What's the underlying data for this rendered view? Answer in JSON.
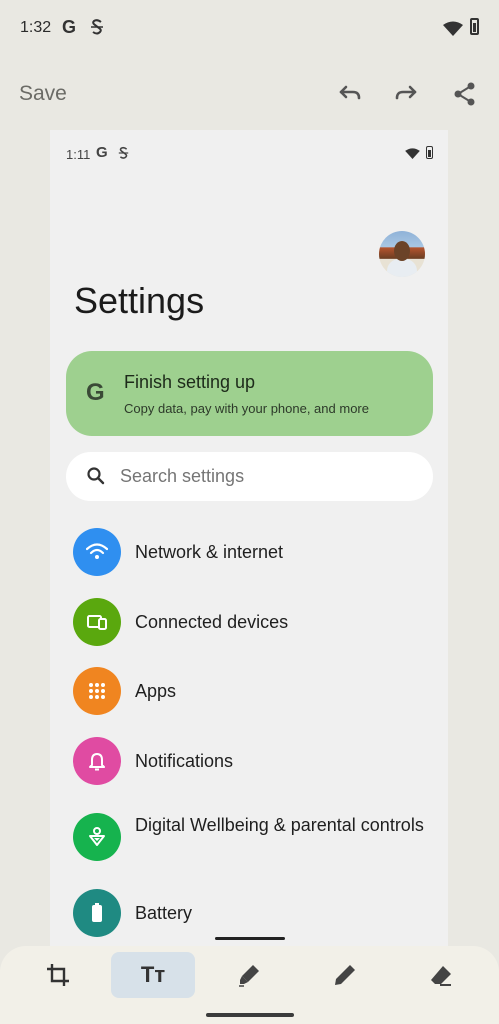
{
  "outer_status": {
    "time": "1:32",
    "g": "G"
  },
  "toolbar": {
    "save_label": "Save"
  },
  "inner_status": {
    "time": "1:11",
    "g": "G"
  },
  "settings": {
    "title": "Settings",
    "setup_card": {
      "g": "G",
      "title": "Finish setting up",
      "subtitle": "Copy data, pay with your phone, and more"
    },
    "search": {
      "placeholder": "Search settings"
    },
    "items": [
      {
        "label": "Network & internet",
        "icon": "wifi-icon",
        "color": "#2f8ff0"
      },
      {
        "label": "Connected devices",
        "icon": "devices-icon",
        "color": "#5aa80e"
      },
      {
        "label": "Apps",
        "icon": "apps-grid-icon",
        "color": "#f08520"
      },
      {
        "label": "Notifications",
        "icon": "bell-icon",
        "color": "#e04ba2"
      },
      {
        "label": "Digital Wellbeing & parental controls",
        "icon": "wellbeing-icon",
        "color": "#16b34e"
      },
      {
        "label": "Battery",
        "icon": "battery-icon",
        "color": "#1f8a82"
      }
    ]
  },
  "bottom_tools": [
    {
      "name": "crop",
      "active": false
    },
    {
      "name": "text",
      "label": "Tт",
      "active": true
    },
    {
      "name": "highlighter",
      "active": false
    },
    {
      "name": "pen",
      "active": false
    },
    {
      "name": "eraser",
      "active": false
    }
  ]
}
